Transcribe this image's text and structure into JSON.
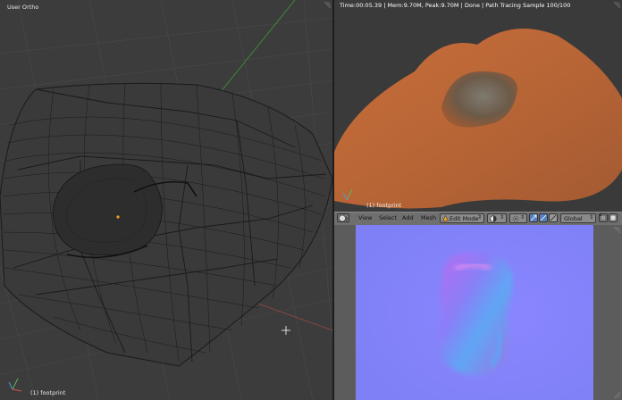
{
  "left_view": {
    "title": "User Ortho",
    "object_label": "(1) footprint"
  },
  "render_view": {
    "status": "Time:00:05.39 | Mem:9.70M, Peak:9.70M | Done | Path Tracing Sample 100/100",
    "object_label": "(1) footprint"
  },
  "toolbar": {
    "view": "View",
    "select": "Select",
    "add": "Add",
    "mesh": "Mesh",
    "mode": "Edit Mode",
    "orientation": "Global"
  },
  "icons": {
    "editor_type": "sphere-icon",
    "mode_dropdown": "chevron-icon",
    "shading": "sphere-shading-icon",
    "pivot": "pivot-icon",
    "manipulator": "arrow-icon",
    "snap": "snap-icon"
  },
  "colors": {
    "viewport_bg": "#3c3c3c",
    "render_orange": "#c0693a",
    "normal_map_bg": "#8080ff",
    "header_bar": "#6f6f6f",
    "axis_x": "#b04040",
    "axis_y": "#40a040"
  }
}
